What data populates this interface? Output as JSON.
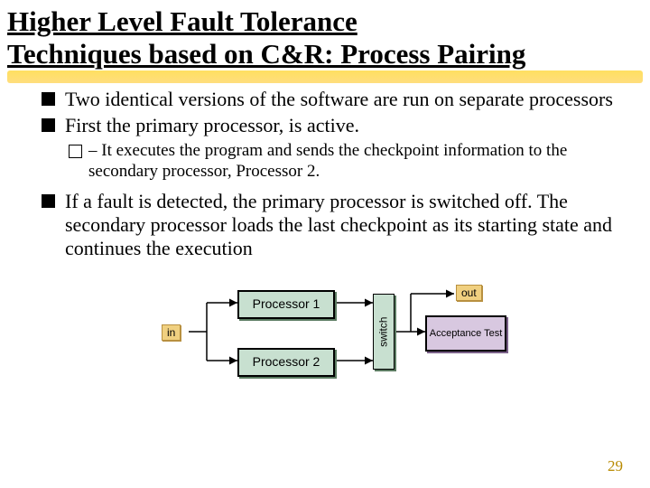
{
  "title_line1": "Higher Level Fault Tolerance",
  "title_line2": "Techniques based on C&R: Process Pairing",
  "bullets": {
    "b1": "Two identical versions of the software are run on separate processors",
    "b2": "First the primary processor, is active.",
    "b2_sub": "– It executes the program and sends the checkpoint information to the secondary processor, Processor 2.",
    "b3": "If a fault is detected, the primary processor is switched off. The secondary processor loads the last checkpoint as its starting state and continues the execution"
  },
  "diagram": {
    "in": "in",
    "out": "out",
    "proc1": "Processor 1",
    "proc2": "Processor 2",
    "switch": "switch",
    "accept": "Acceptance Test"
  },
  "page_number": "29"
}
